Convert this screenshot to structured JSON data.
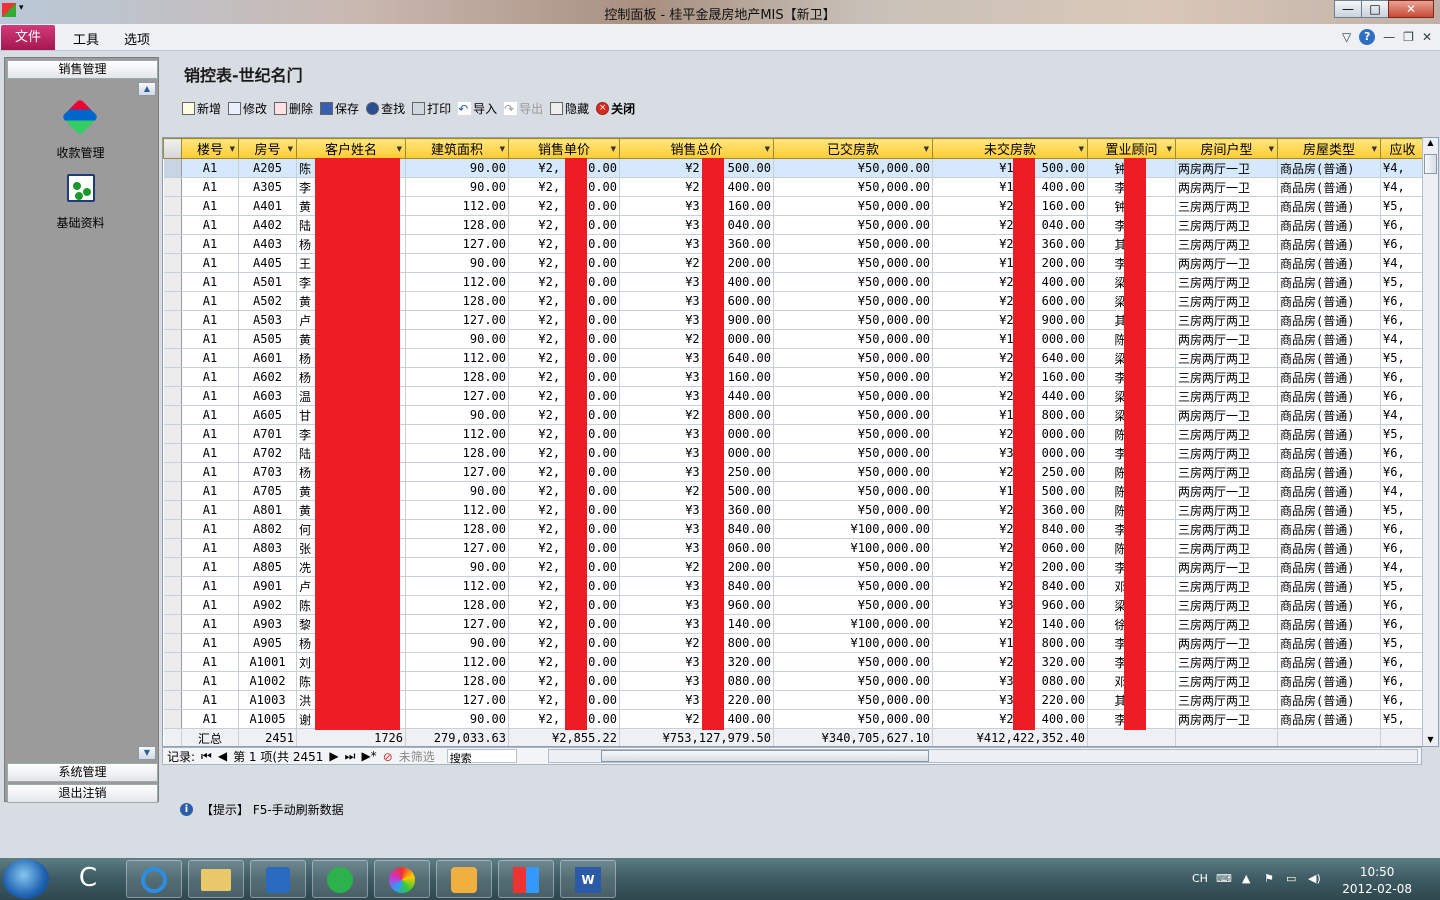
{
  "window": {
    "title": "控制面板 - 桂平金晟房地产MIS【新卫】"
  },
  "menu": {
    "file": "文件",
    "tools": "工具",
    "options": "选项"
  },
  "sidebar": {
    "section_sales": "销售管理",
    "tools": [
      {
        "label": "收款管理",
        "icon": "payment-icon"
      },
      {
        "label": "基础资料",
        "icon": "basic-data-icon"
      }
    ],
    "section_system": "系统管理",
    "section_logout": "退出注销"
  },
  "page": {
    "title": "销控表-世纪名门"
  },
  "toolbar": {
    "new": "新增",
    "edit": "修改",
    "delete": "删除",
    "save": "保存",
    "find": "查找",
    "print": "打印",
    "import": "导入",
    "export": "导出",
    "hide": "隐藏",
    "close": "关闭"
  },
  "grid": {
    "columns": [
      "楼号",
      "房号",
      "客户姓名",
      "建筑面积",
      "销售单价",
      "销售总价",
      "已交房款",
      "未交房款",
      "置业顾问",
      "房间户型",
      "房屋类型",
      "应收"
    ],
    "rows": [
      [
        "A1",
        "A205",
        "陈",
        "90.00",
        "¥2,",
        "0.00",
        "¥2",
        "500.00",
        "¥50,000.00",
        "¥1",
        "500.00",
        "钟",
        "",
        "两房两厅一卫",
        "商品房(普通)",
        "¥4,"
      ],
      [
        "A1",
        "A305",
        "李",
        "90.00",
        "¥2,",
        "0.00",
        "¥2",
        "400.00",
        "¥50,000.00",
        "¥1",
        "400.00",
        "李",
        "",
        "两房两厅一卫",
        "商品房(普通)",
        "¥4,"
      ],
      [
        "A1",
        "A401",
        "黄",
        "112.00",
        "¥2,",
        "0.00",
        "¥3",
        "160.00",
        "¥50,000.00",
        "¥2",
        "160.00",
        "钟",
        "",
        "三房两厅两卫",
        "商品房(普通)",
        "¥5,"
      ],
      [
        "A1",
        "A402",
        "陆",
        "128.00",
        "¥2,",
        "0.00",
        "¥3",
        "040.00",
        "¥50,000.00",
        "¥2",
        "040.00",
        "李",
        "",
        "三房两厅两卫",
        "商品房(普通)",
        "¥6,"
      ],
      [
        "A1",
        "A403",
        "杨",
        "127.00",
        "¥2,",
        "0.00",
        "¥3",
        "360.00",
        "¥50,000.00",
        "¥2",
        "360.00",
        "其",
        "",
        "三房两厅两卫",
        "商品房(普通)",
        "¥6,"
      ],
      [
        "A1",
        "A405",
        "王",
        "90.00",
        "¥2,",
        "0.00",
        "¥2",
        "200.00",
        "¥50,000.00",
        "¥1",
        "200.00",
        "李",
        "",
        "两房两厅一卫",
        "商品房(普通)",
        "¥4,"
      ],
      [
        "A1",
        "A501",
        "李",
        "112.00",
        "¥2,",
        "0.00",
        "¥3",
        "400.00",
        "¥50,000.00",
        "¥2",
        "400.00",
        "梁",
        "",
        "三房两厅两卫",
        "商品房(普通)",
        "¥5,"
      ],
      [
        "A1",
        "A502",
        "黄",
        "128.00",
        "¥2,",
        "0.00",
        "¥3",
        "600.00",
        "¥50,000.00",
        "¥2",
        "600.00",
        "梁",
        "",
        "三房两厅两卫",
        "商品房(普通)",
        "¥6,"
      ],
      [
        "A1",
        "A503",
        "卢",
        "127.00",
        "¥2,",
        "0.00",
        "¥3",
        "900.00",
        "¥50,000.00",
        "¥2",
        "900.00",
        "其",
        "",
        "三房两厅两卫",
        "商品房(普通)",
        "¥6,"
      ],
      [
        "A1",
        "A505",
        "黄",
        "90.00",
        "¥2,",
        "0.00",
        "¥2",
        "000.00",
        "¥50,000.00",
        "¥1",
        "000.00",
        "陈",
        "",
        "两房两厅一卫",
        "商品房(普通)",
        "¥4,"
      ],
      [
        "A1",
        "A601",
        "杨",
        "112.00",
        "¥2,",
        "0.00",
        "¥3",
        "640.00",
        "¥50,000.00",
        "¥2",
        "640.00",
        "梁",
        "",
        "三房两厅两卫",
        "商品房(普通)",
        "¥5,"
      ],
      [
        "A1",
        "A602",
        "杨",
        "128.00",
        "¥2,",
        "0.00",
        "¥3",
        "160.00",
        "¥50,000.00",
        "¥2",
        "160.00",
        "李",
        "",
        "三房两厅两卫",
        "商品房(普通)",
        "¥6,"
      ],
      [
        "A1",
        "A603",
        "温",
        "127.00",
        "¥2,",
        "0.00",
        "¥3",
        "440.00",
        "¥50,000.00",
        "¥2",
        "440.00",
        "梁",
        "",
        "三房两厅两卫",
        "商品房(普通)",
        "¥6,"
      ],
      [
        "A1",
        "A605",
        "甘",
        "90.00",
        "¥2,",
        "0.00",
        "¥2",
        "800.00",
        "¥50,000.00",
        "¥1",
        "800.00",
        "梁",
        "",
        "两房两厅一卫",
        "商品房(普通)",
        "¥4,"
      ],
      [
        "A1",
        "A701",
        "李",
        "112.00",
        "¥2,",
        "0.00",
        "¥3",
        "000.00",
        "¥50,000.00",
        "¥2",
        "000.00",
        "陈",
        "",
        "三房两厅两卫",
        "商品房(普通)",
        "¥5,"
      ],
      [
        "A1",
        "A702",
        "陆",
        "128.00",
        "¥2,",
        "0.00",
        "¥3",
        "000.00",
        "¥50,000.00",
        "¥3",
        "000.00",
        "李",
        "",
        "三房两厅两卫",
        "商品房(普通)",
        "¥6,"
      ],
      [
        "A1",
        "A703",
        "杨",
        "127.00",
        "¥2,",
        "0.00",
        "¥3",
        "250.00",
        "¥50,000.00",
        "¥2",
        "250.00",
        "陈",
        "",
        "三房两厅两卫",
        "商品房(普通)",
        "¥6,"
      ],
      [
        "A1",
        "A705",
        "黄",
        "90.00",
        "¥2,",
        "0.00",
        "¥2",
        "500.00",
        "¥50,000.00",
        "¥1",
        "500.00",
        "陈",
        "",
        "两房两厅一卫",
        "商品房(普通)",
        "¥4,"
      ],
      [
        "A1",
        "A801",
        "黄",
        "112.00",
        "¥2,",
        "0.00",
        "¥3",
        "360.00",
        "¥50,000.00",
        "¥2",
        "360.00",
        "陈",
        "",
        "三房两厅两卫",
        "商品房(普通)",
        "¥5,"
      ],
      [
        "A1",
        "A802",
        "何",
        "128.00",
        "¥2,",
        "0.00",
        "¥3",
        "840.00",
        "¥100,000.00",
        "¥2",
        "840.00",
        "李",
        "",
        "三房两厅两卫",
        "商品房(普通)",
        "¥6,"
      ],
      [
        "A1",
        "A803",
        "张",
        "127.00",
        "¥2,",
        "0.00",
        "¥3",
        "060.00",
        "¥100,000.00",
        "¥2",
        "060.00",
        "陈",
        "",
        "三房两厅两卫",
        "商品房(普通)",
        "¥6,"
      ],
      [
        "A1",
        "A805",
        "冼",
        "90.00",
        "¥2,",
        "0.00",
        "¥2",
        "200.00",
        "¥50,000.00",
        "¥2",
        "200.00",
        "李",
        "",
        "两房两厅一卫",
        "商品房(普通)",
        "¥4,"
      ],
      [
        "A1",
        "A901",
        "卢",
        "112.00",
        "¥2,",
        "0.00",
        "¥3",
        "840.00",
        "¥50,000.00",
        "¥2",
        "840.00",
        "邓",
        "",
        "三房两厅两卫",
        "商品房(普通)",
        "¥5,"
      ],
      [
        "A1",
        "A902",
        "陈",
        "128.00",
        "¥2,",
        "0.00",
        "¥3",
        "960.00",
        "¥50,000.00",
        "¥3",
        "960.00",
        "梁",
        "",
        "三房两厅两卫",
        "商品房(普通)",
        "¥6,"
      ],
      [
        "A1",
        "A903",
        "黎",
        "127.00",
        "¥2,",
        "0.00",
        "¥3",
        "140.00",
        "¥100,000.00",
        "¥2",
        "140.00",
        "徐",
        "",
        "三房两厅两卫",
        "商品房(普通)",
        "¥6,"
      ],
      [
        "A1",
        "A905",
        "杨",
        "90.00",
        "¥2,",
        "0.00",
        "¥2",
        "800.00",
        "¥100,000.00",
        "¥1",
        "800.00",
        "李",
        "",
        "两房两厅一卫",
        "商品房(普通)",
        "¥5,"
      ],
      [
        "A1",
        "A1001",
        "刘",
        "112.00",
        "¥2,",
        "0.00",
        "¥3",
        "320.00",
        "¥50,000.00",
        "¥2",
        "320.00",
        "李",
        "",
        "三房两厅两卫",
        "商品房(普通)",
        "¥6,"
      ],
      [
        "A1",
        "A1002",
        "陈",
        "128.00",
        "¥2,",
        "0.00",
        "¥3",
        "080.00",
        "¥50,000.00",
        "¥3",
        "080.00",
        "邓",
        "",
        "三房两厅两卫",
        "商品房(普通)",
        "¥6,"
      ],
      [
        "A1",
        "A1003",
        "洪",
        "127.00",
        "¥2,",
        "0.00",
        "¥3",
        "220.00",
        "¥50,000.00",
        "¥3",
        "220.00",
        "其",
        "",
        "三房两厅两卫",
        "商品房(普通)",
        "¥6,"
      ],
      [
        "A1",
        "A1005",
        "谢",
        "90.00",
        "¥2,",
        "0.00",
        "¥2",
        "400.00",
        "¥50,000.00",
        "¥2",
        "400.00",
        "李",
        "",
        "两房两厅一卫",
        "商品房(普通)",
        "¥5,"
      ]
    ],
    "summary": {
      "label": "汇总",
      "count": "2451",
      "customers": "1726",
      "area": "279,033.63",
      "unit_price": "¥2,855.22",
      "total": "¥753,127,979.50",
      "paid": "¥340,705,627.10",
      "unpaid": "¥412,422,352.40"
    }
  },
  "navbar": {
    "records": "记录:",
    "position": "第 1 项(共 2451",
    "filter": "未筛选",
    "search": "搜索"
  },
  "status": {
    "hint": "【提示】 F5-手动刷新数据"
  },
  "taskbar": {
    "clock_time": "10:50",
    "clock_date": "2012-02-08",
    "lang": "CH"
  }
}
